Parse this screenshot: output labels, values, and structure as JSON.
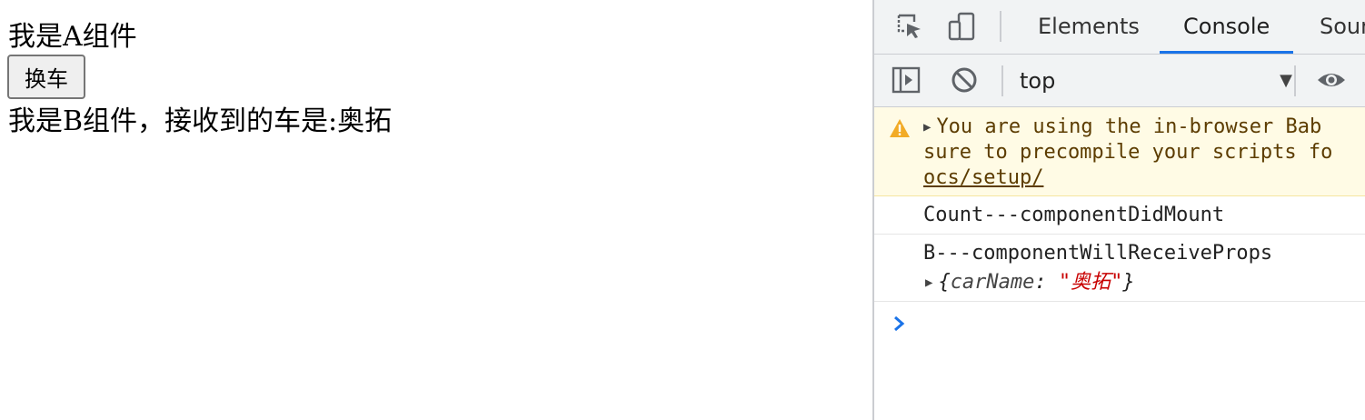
{
  "page": {
    "component_a_title": "我是A组件",
    "swap_button_label": "换车",
    "component_b_text": "我是B组件，接收到的车是:奥拓"
  },
  "devtools": {
    "tabs": [
      {
        "label": "Elements"
      },
      {
        "label": "Console",
        "active": true
      },
      {
        "label": "Sour"
      }
    ],
    "context": "top",
    "console": {
      "warning_line1": "You are using the in-browser Bab",
      "warning_line2": "sure to precompile your scripts fo",
      "warning_link": "ocs/setup/",
      "log1": "Count---componentDidMount",
      "log2": "B---componentWillReceiveProps",
      "log2_obj_open": "{",
      "log2_obj_key": "carName",
      "log2_obj_colon": ": ",
      "log2_obj_value": "\"奥拓\"",
      "log2_obj_close": "}"
    },
    "colors": {
      "accent": "#1a73e8",
      "warning_bg": "#fffbe5",
      "string_value": "#c80000"
    }
  }
}
